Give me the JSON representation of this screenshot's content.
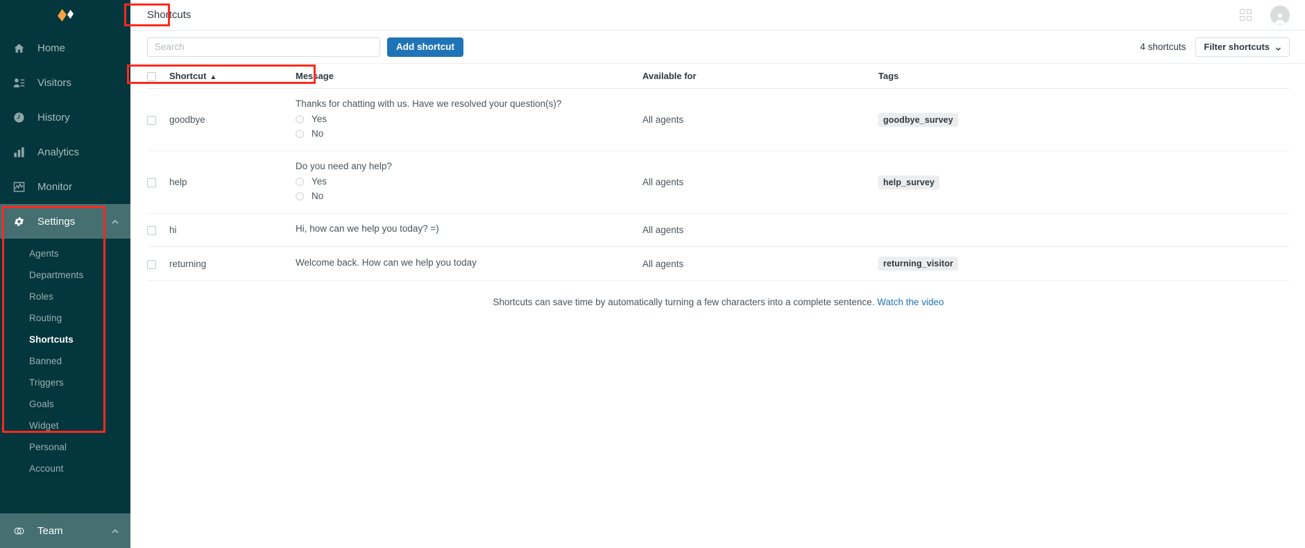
{
  "sidebar": {
    "logo_name": "zendesk-chat-logo",
    "items": [
      {
        "label": "Home",
        "icon": "home-icon",
        "active": false,
        "expandable": false
      },
      {
        "label": "Visitors",
        "icon": "visitors-icon",
        "active": false,
        "expandable": false
      },
      {
        "label": "History",
        "icon": "history-icon",
        "active": false,
        "expandable": false
      },
      {
        "label": "Analytics",
        "icon": "analytics-icon",
        "active": false,
        "expandable": false
      },
      {
        "label": "Monitor",
        "icon": "monitor-icon",
        "active": false,
        "expandable": false
      },
      {
        "label": "Settings",
        "icon": "gear-icon",
        "active": true,
        "expandable": true
      }
    ],
    "settings_submenu": [
      {
        "label": "Agents",
        "active": false
      },
      {
        "label": "Departments",
        "active": false
      },
      {
        "label": "Roles",
        "active": false
      },
      {
        "label": "Routing",
        "active": false
      },
      {
        "label": "Shortcuts",
        "active": true
      },
      {
        "label": "Banned",
        "active": false
      },
      {
        "label": "Triggers",
        "active": false
      },
      {
        "label": "Goals",
        "active": false
      },
      {
        "label": "Widget",
        "active": false
      },
      {
        "label": "Personal",
        "active": false
      },
      {
        "label": "Account",
        "active": false
      }
    ],
    "bottom_item": {
      "label": "Team",
      "icon": "team-icon",
      "expandable": true
    }
  },
  "topbar": {
    "title": "Shortcuts",
    "apps_icon": "grid-apps-icon",
    "avatar_icon": "user-avatar-icon"
  },
  "toolbar": {
    "search_placeholder": "Search",
    "search_value": "",
    "add_button_label": "Add shortcut",
    "count_label": "4 shortcuts",
    "filter_label": "Filter shortcuts",
    "filter_caret_icon": "chevron-down-icon"
  },
  "table": {
    "columns": {
      "shortcut": "Shortcut",
      "sort_indicator": "▲",
      "message": "Message",
      "available_for": "Available for",
      "tags": "Tags"
    },
    "rows": [
      {
        "shortcut": "goodbye",
        "message": "Thanks for chatting with us. Have we resolved your question(s)?",
        "options": [
          "Yes",
          "No"
        ],
        "available_for": "All agents",
        "tag": "goodbye_survey"
      },
      {
        "shortcut": "help",
        "message": "Do you need any help?",
        "options": [
          "Yes",
          "No"
        ],
        "available_for": "All agents",
        "tag": "help_survey"
      },
      {
        "shortcut": "hi",
        "message": "Hi, how can we help you today? =)",
        "options": [],
        "available_for": "All agents",
        "tag": ""
      },
      {
        "shortcut": "returning",
        "message": "Welcome back. How can we help you today",
        "options": [],
        "available_for": "All agents",
        "tag": "returning_visitor"
      }
    ]
  },
  "footer": {
    "text": "Shortcuts can save time by automatically turning a few characters into a complete sentence.",
    "link_label": "Watch the video"
  },
  "colors": {
    "sidebar_bg": "#03363d",
    "sidebar_active": "#456f71",
    "primary_button": "#1f73b7",
    "link": "#1f73b7",
    "annotation": "#ff2a1f",
    "logo_orange": "#f5a142"
  }
}
